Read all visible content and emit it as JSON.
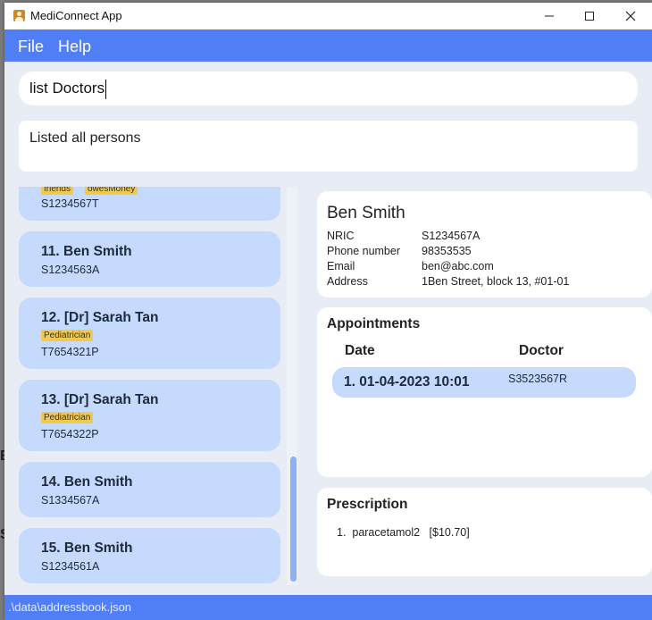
{
  "window": {
    "title": "MediConnect App",
    "icon": "contacts-book-icon",
    "controls": [
      "minimize-icon",
      "maximize-icon",
      "close-icon"
    ]
  },
  "menu": {
    "file": "File",
    "help": "Help"
  },
  "command": {
    "value": "list Doctors"
  },
  "result": {
    "text": "Listed all persons"
  },
  "person_list": {
    "partial_card": {
      "tags": [
        "friends",
        "owesMoney"
      ],
      "nric": "S1234567T"
    },
    "cards": [
      {
        "title": "11.  Ben Smith",
        "tag": "",
        "nric": "S1234563A"
      },
      {
        "title": "12.  [Dr] Sarah Tan",
        "tag": "Pediatrician",
        "nric": "T7654321P"
      },
      {
        "title": "13.  [Dr] Sarah Tan",
        "tag": "Pediatrician",
        "nric": "T7654322P"
      },
      {
        "title": "14.  Ben Smith",
        "tag": "",
        "nric": "S1334567A"
      },
      {
        "title": "15.  Ben Smith",
        "tag": "",
        "nric": "S1234561A"
      }
    ]
  },
  "detail": {
    "name": "Ben Smith",
    "fields": [
      {
        "label": "NRIC",
        "value": "S1234567A"
      },
      {
        "label": "Phone number",
        "value": "98353535"
      },
      {
        "label": "Email",
        "value": "ben@abc.com"
      },
      {
        "label": "Address",
        "value": "1Ben Street, block 13, #01-01"
      }
    ]
  },
  "appointments": {
    "title": "Appointments",
    "col_date": "Date",
    "col_doctor": "Doctor",
    "rows": [
      {
        "index_date": "1.  01-04-2023 10:01",
        "doctor": "S3523567R"
      }
    ]
  },
  "prescription": {
    "title": "Prescription",
    "items": [
      {
        "text": "1.  paracetamol2   [$10.70]"
      }
    ]
  },
  "statusbar": {
    "path": ".\\data\\addressbook.json"
  },
  "colors": {
    "accent": "#4f7ef7",
    "card": "#c5dafc",
    "tag": "#f2c94c",
    "background": "#e7ecf5"
  }
}
